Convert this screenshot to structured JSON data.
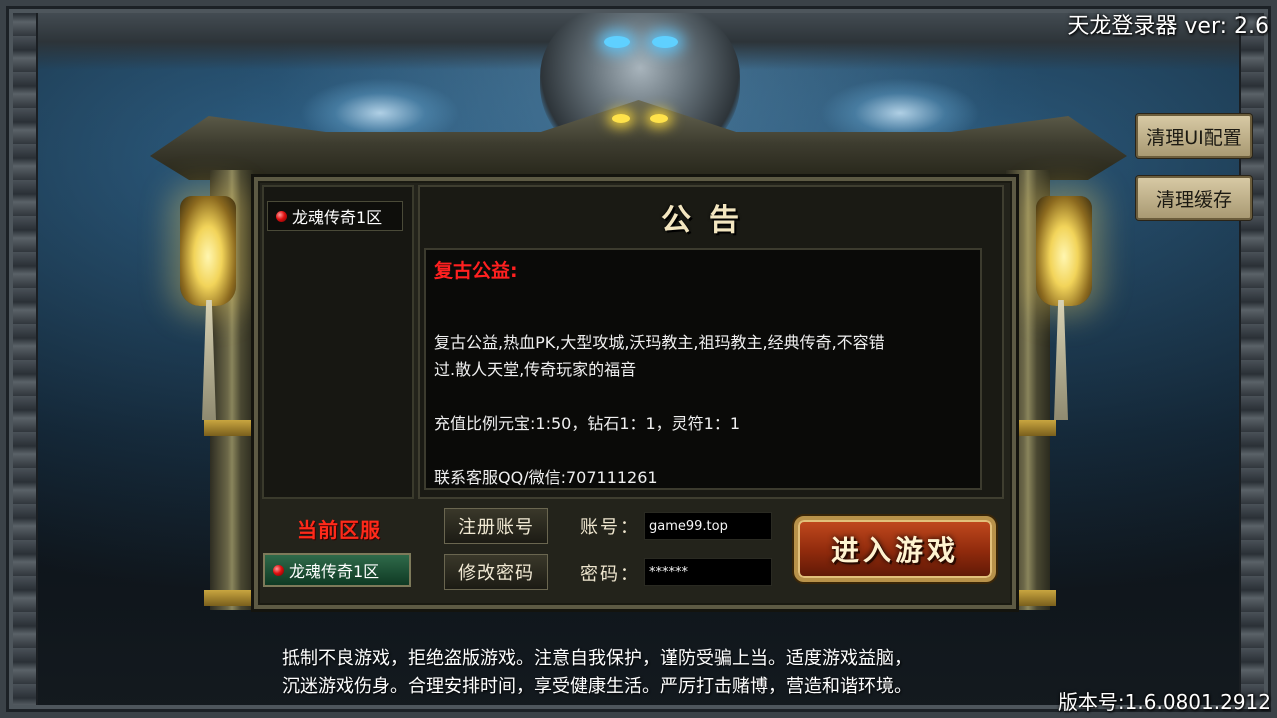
{
  "app": {
    "title": "天龙登录器 ver: 2.6",
    "version": "版本号:1.6.0801.2912"
  },
  "utility_buttons": {
    "clear_ui": "清理UI配置",
    "clear_cache": "清理缓存"
  },
  "server_list": {
    "items": [
      {
        "label": "龙魂传奇1区",
        "status_color": "#e01010"
      }
    ]
  },
  "notice": {
    "title": "公告",
    "heading": "复古公益:",
    "lines": [
      " 复古公益,热血PK,大型攻城,沃玛教主,祖玛教主,经典传奇,不容错",
      "过.散人天堂,传奇玩家的福音",
      "充值比例元宝:1:50，钻石1：1，灵符1：1",
      "联系客服QQ/微信:707111261"
    ]
  },
  "current_server": {
    "label": "当前区服",
    "name": "龙魂传奇1区"
  },
  "account": {
    "register_button": "注册账号",
    "change_password_button": "修改密码",
    "account_label": "账号：",
    "account_value": "game99.top",
    "password_label": "密码：",
    "password_value": "******",
    "enter_button": "进入游戏"
  },
  "disclaimer": {
    "line1": "抵制不良游戏，拒绝盗版游戏。注意自我保护，谨防受骗上当。适度游戏益脑，",
    "line2": "沉迷游戏伤身。合理安排时间，享受健康生活。严厉打击赌博，营造和谐环境。"
  },
  "colors": {
    "heading_red": "#ff2020",
    "current_label_red": "#ff2a1a",
    "enter_button": "#8f2a0c",
    "panel": "#23231b"
  }
}
